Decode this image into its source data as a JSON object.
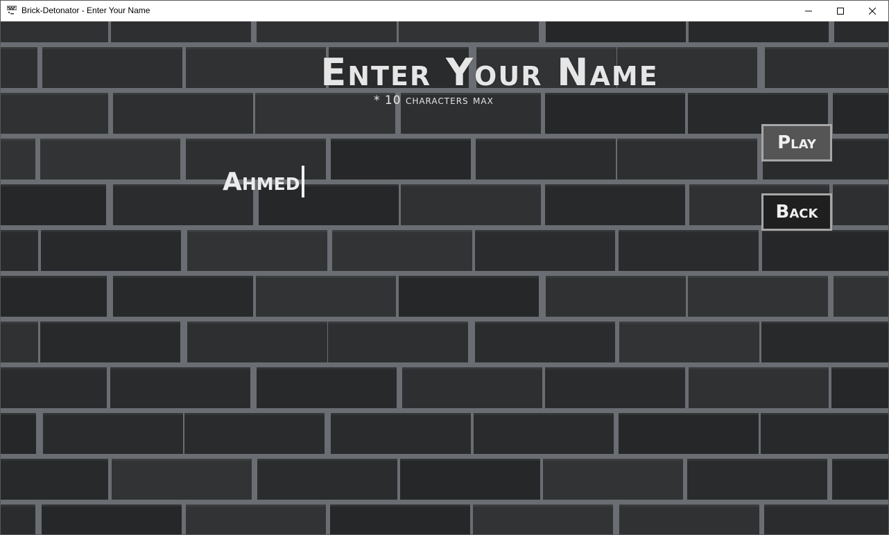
{
  "window": {
    "title": "Brick-Detonator - Enter Your Name",
    "controls": {
      "minimize_glyph": "—",
      "maximize_glyph": "☐",
      "close_glyph": "✕"
    }
  },
  "screen": {
    "heading": "Enter Your Name",
    "subheading": "* 10 characters max",
    "name_value": "Ahmed",
    "play_label": "Play",
    "back_label": "Back"
  },
  "colors": {
    "background_brick": "#2b2c2e",
    "mortar": "#6a6d72",
    "text": "#e6e6e6",
    "play_button_bg": "#555556",
    "back_button_bg": "#1f1f20",
    "button_border": "#a7a7a7"
  },
  "icons": {
    "app_icon": "brick-app-icon",
    "minimize": "minimize-icon",
    "maximize": "maximize-icon",
    "close": "close-icon"
  }
}
